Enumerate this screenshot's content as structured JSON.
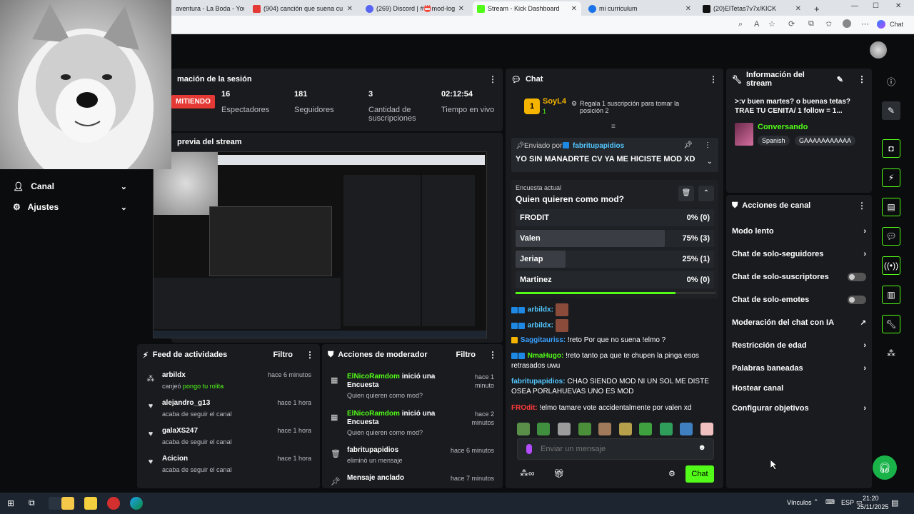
{
  "browser": {
    "tabs": [
      {
        "label": "aventura - La Boda - YouTu"
      },
      {
        "label": "(904) canción que suena cu"
      },
      {
        "label": "(269) Discord | #📛mod-log"
      },
      {
        "label": "Stream - Kick Dashboard"
      },
      {
        "label": "mi curriculum"
      },
      {
        "label": "(20)ElTetas7v7x/KICK"
      }
    ],
    "right_label": "Chat"
  },
  "sidebar": {
    "items": [
      {
        "label": "Canal"
      },
      {
        "label": "Ajustes"
      }
    ]
  },
  "session": {
    "title": "mación de la sesión",
    "live_label": "MITIENDO",
    "stats": [
      {
        "value": "16",
        "label": "Espectadores"
      },
      {
        "value": "181",
        "label": "Seguidores"
      },
      {
        "value": "3",
        "label": "Cantidad de suscripciones"
      },
      {
        "value": "02:12:54",
        "label": "Tiempo en vivo"
      }
    ]
  },
  "preview": {
    "title": "previa del stream"
  },
  "feed": {
    "title": "Feed de actividades",
    "filter": "Filtro",
    "items": [
      {
        "name": "arbildx",
        "sub_prefix": "canjeó",
        "sub_highlight": "pongo tu rolita",
        "time": "hace 6 minutos"
      },
      {
        "name": "alejandro_g13",
        "sub_prefix": "acaba de seguir el canal",
        "sub_highlight": "",
        "time": "hace 1 hora"
      },
      {
        "name": "galaXS247",
        "sub_prefix": "acaba de seguir el canal",
        "sub_highlight": "",
        "time": "hace 1 hora"
      },
      {
        "name": "Acicion",
        "sub_prefix": "acaba de seguir el canal",
        "sub_highlight": "",
        "time": "hace 1 hora"
      }
    ]
  },
  "modactions": {
    "title": "Acciones de moderador",
    "filter": "Filtro",
    "items": [
      {
        "name": "ElNicoRamdom",
        "action": "inició una Encuesta",
        "sub": "Quien quieren como mod?",
        "time": "hace 1 minuto"
      },
      {
        "name": "ElNicoRamdom",
        "action": "inició una Encuesta",
        "sub": "Quien quieren como mod?",
        "time": "hace 2 minutos"
      },
      {
        "name": "fabritupapidios",
        "action": "",
        "sub": "eliminó un mensaje",
        "time": "hace 6 minutos"
      },
      {
        "name": "Mensaje anclado",
        "action": "",
        "sub": "",
        "time": "hace 7 minutos"
      }
    ]
  },
  "chat": {
    "title": "Chat",
    "gift_user": "SoyL4",
    "gift_rank": "1",
    "gift_count": "1",
    "gift_text": "Regala 1 suscripción para tomar la posición 2",
    "pinned_by_prefix": "Enviado por",
    "pinned_by": "fabritupapidios",
    "pinned_text": "YO SIN MANADRTE CV YA ME HICISTE MOD XD",
    "poll_label": "Encuesta actual",
    "poll_question": "Quien quieren como mod?",
    "poll_options": [
      {
        "label": "FRODIT",
        "pct": "0% (0)",
        "fraction": 0
      },
      {
        "label": "Valen",
        "pct": "75% (3)",
        "fraction": 0.75
      },
      {
        "label": "Jeriap",
        "pct": "25% (1)",
        "fraction": 0.25
      },
      {
        "label": "Martinez",
        "pct": "0% (0)",
        "fraction": 0
      }
    ],
    "poll_progress": 0.8,
    "messages": [
      {
        "user": "arbildx:",
        "text": "",
        "color": "#53c8ff"
      },
      {
        "user": "arbildx:",
        "text": "",
        "color": "#53c8ff"
      },
      {
        "user": "Saggitauriss:",
        "text": "!reto Por que no suena !elmo ?",
        "color": "#3aa0ff"
      },
      {
        "user": "NmaHugo:",
        "text": "!reto tanto pa que te chupen la pinga esos retrasados uwu",
        "color": "#53fc18"
      },
      {
        "user": "fabritupapidios:",
        "text": "CHAO SIENDO MOD NI UN SOL ME DISTE OSEA PORLAHUEVAS UNO ES MOD",
        "color": "#53c8ff"
      },
      {
        "user": "FROdit:",
        "text": "!elmo tamare vote accidentalmente por valen xd",
        "color": "#ff3b3b"
      }
    ],
    "input_placeholder": "Enviar un mensaje",
    "send_label": "Chat"
  },
  "streaminfo": {
    "title": "Información del stream",
    "stream_title": ">:v buen martes? o buenas tetas? TRAE TU CENITA/ 1 follow = 1...",
    "category": "Conversando",
    "tags": [
      "Spanish",
      "GAAAAAAAAAAA"
    ]
  },
  "channelactions": {
    "title": "Acciones de canal",
    "items": [
      {
        "label": "Modo lento",
        "kind": "chevron"
      },
      {
        "label": "Chat de solo-seguidores",
        "kind": "chevron"
      },
      {
        "label": "Chat de solo-suscriptores",
        "kind": "toggle"
      },
      {
        "label": "Chat de solo-emotes",
        "kind": "toggle"
      },
      {
        "label": "Moderación del chat con IA",
        "kind": "external"
      },
      {
        "label": "Restricción de edad",
        "kind": "chevron"
      },
      {
        "label": "Palabras baneadas",
        "kind": "chevron"
      },
      {
        "label": "Hostear canal",
        "kind": "none"
      },
      {
        "label": "Configurar objetivos",
        "kind": "chevron"
      }
    ]
  },
  "taskbar": {
    "links_label": "Vínculos",
    "lang": "ESP",
    "time": "21:20",
    "date": "25/11/2025"
  },
  "colors": {
    "accent": "#53fc18",
    "panel": "#191b1f",
    "live": "#e53935"
  }
}
